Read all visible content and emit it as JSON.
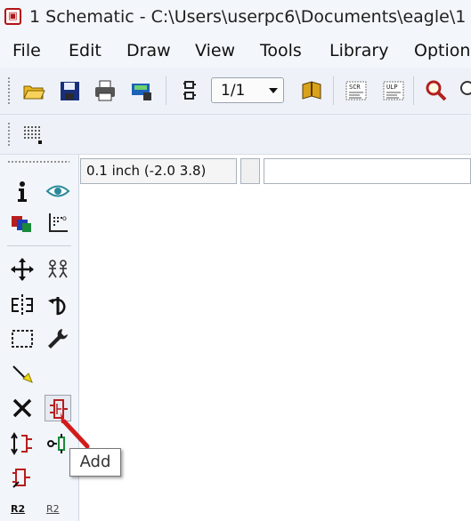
{
  "window": {
    "title": "1 Schematic - C:\\Users\\userpc6\\Documents\\eagle\\1"
  },
  "menu": [
    "File",
    "Edit",
    "Draw",
    "View",
    "Tools",
    "Library",
    "Option"
  ],
  "toolbar": {
    "zoom_value": "1/1",
    "icons": [
      "open-icon",
      "save-icon",
      "print-icon",
      "cam-icon",
      "sheets-icon",
      "zoom-select",
      "library-book-icon",
      "script-icon",
      "ulp-icon",
      "zoom-fit-icon"
    ]
  },
  "status": {
    "coordinates": "0.1 inch (-2.0 3.8)",
    "command": ""
  },
  "sidebar": {
    "tools": [
      "info",
      "show",
      "display-layers",
      "mark",
      "move",
      "copy",
      "mirror",
      "rotate",
      "group",
      "change",
      "wire",
      "delete",
      "add",
      "replace",
      "gate-swap",
      "split",
      "name",
      "value"
    ],
    "name_label": "R2",
    "value_label": "R2"
  },
  "tooltip": {
    "text": "Add"
  },
  "colors": {
    "accent_red": "#d11c1c",
    "title_bg": "#f3f6fb",
    "toolbar_bg": "#eef2f8"
  }
}
